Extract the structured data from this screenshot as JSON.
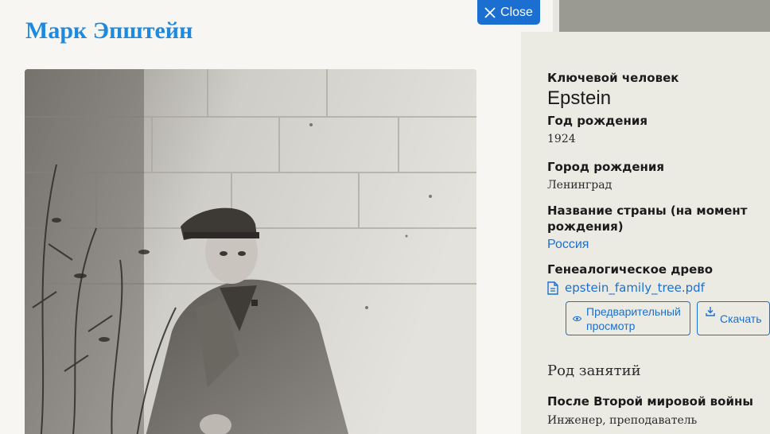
{
  "close": {
    "label": "Close"
  },
  "title": "Марк Эпштейн",
  "details": {
    "key_person_label": "Ключевой человек",
    "key_person_value": "Epstein",
    "birth_year_label": "Год рождения",
    "birth_year_value": "1924",
    "birth_city_label": "Город рождения",
    "birth_city_value": "Ленинград",
    "country_label_line1": "Название страны (на момент",
    "country_label_line2": "рождения)",
    "country_value": "Россия",
    "tree_label": "Генеалогическое древо",
    "tree_file": "epstein_family_tree.pdf",
    "preview_line1": "Предварительный",
    "preview_line2": "просмотр",
    "download_label": "Скачать",
    "occupation_heading": "Род занятий",
    "postwar_label": "После Второй мировой войны",
    "postwar_value": "Инженер, преподаватель"
  },
  "icons": {
    "close": "close-icon",
    "file": "file-icon",
    "eye": "eye-icon",
    "download": "download-icon"
  },
  "colors": {
    "accent": "#1a6fd1",
    "title": "#1d8ae0",
    "panel": "#ecebe3",
    "page": "#f8f6f2"
  }
}
